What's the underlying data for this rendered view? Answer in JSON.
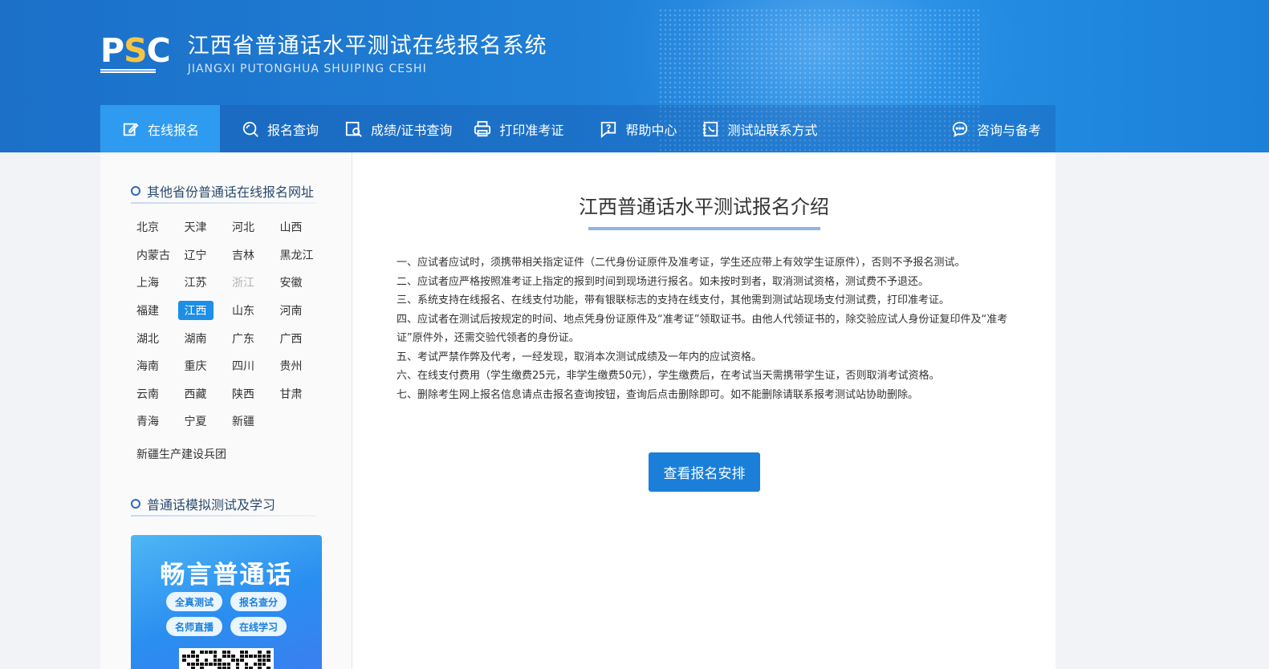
{
  "header": {
    "logo_text": "PSC",
    "title": "江西省普通话水平测试在线报名系统",
    "subtitle": "JIANGXI PUTONGHUA SHUIPING CESHI"
  },
  "nav": {
    "items": [
      {
        "label": "在线报名",
        "icon": "edit-icon"
      },
      {
        "label": "报名查询",
        "icon": "search-icon"
      },
      {
        "label": "成绩/证书查询",
        "icon": "certificate-search-icon"
      },
      {
        "label": "打印准考证",
        "icon": "printer-icon"
      },
      {
        "label": "帮助中心",
        "icon": "help-icon"
      },
      {
        "label": "测试站联系方式",
        "icon": "contact-icon"
      },
      {
        "label": "咨询与备考",
        "icon": "chat-icon"
      }
    ],
    "active_index": 0
  },
  "sidebar": {
    "provinces_title": "其他省份普通话在线报名网址",
    "provinces": [
      "北京",
      "天津",
      "河北",
      "山西",
      "内蒙古",
      "辽宁",
      "吉林",
      "黑龙江",
      "上海",
      "江苏",
      "浙江",
      "安徽",
      "福建",
      "江西",
      "山东",
      "河南",
      "湖北",
      "湖南",
      "广东",
      "广西",
      "海南",
      "重庆",
      "四川",
      "贵州",
      "云南",
      "西藏",
      "陕西",
      "甘肃",
      "青海",
      "宁夏",
      "新疆"
    ],
    "selected_province": "江西",
    "disabled_province": "浙江",
    "extra_link": "新疆生产建设兵团",
    "study_title": "普通话模拟测试及学习",
    "promo": {
      "title": "畅言普通话",
      "tags": [
        "全真测试",
        "报名查分",
        "名师直播",
        "在线学习"
      ]
    }
  },
  "main": {
    "title": "江西普通话水平测试报名介绍",
    "rules": [
      "一、应试者应试时，须携带相关指定证件（二代身份证原件及准考证，学生还应带上有效学生证原件），否则不予报名测试。",
      "二、应试者应严格按照准考证上指定的报到时间到现场进行报名。如未按时到者，取消测试资格，测试费不予退还。",
      "三、系统支持在线报名、在线支付功能，带有银联标志的支持在线支付，其他需到测试站现场支付测试费，打印准考证。",
      "四、应试者在测试后按规定的时间、地点凭身份证原件及“准考证”领取证书。由他人代领证书的，除交验应试人身份证复印件及“准考证”原件外，还需交验代领者的身份证。",
      "五、考试严禁作弊及代考，一经发现，取消本次测试成绩及一年内的应试资格。",
      "六、在线支付费用（学生缴费25元，非学生缴费50元），学生缴费后，在考试当天需携带学生证，否则取消考试资格。",
      "七、删除考生网上报名信息请点击报名查询按钮，查询后点击删除即可。如不能删除请联系报考测试站协助删除。"
    ],
    "cta_label": "查看报名安排"
  }
}
